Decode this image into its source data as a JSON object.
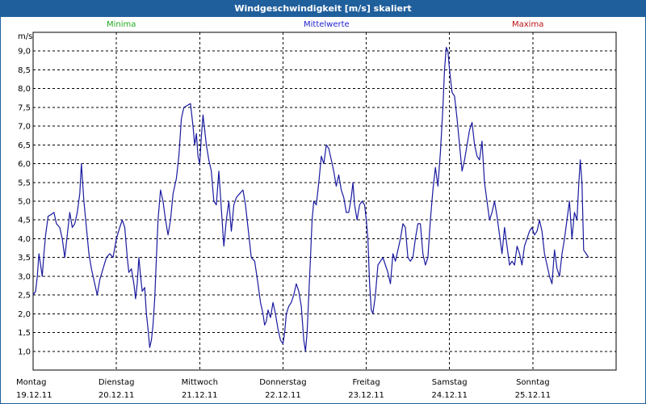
{
  "window": {
    "title": "Windgeschwindigkeit [m/s] skaliert"
  },
  "legend": [
    {
      "label": "Minima",
      "color": "#22aa22"
    },
    {
      "label": "Mittelwerte",
      "color": "#2222cc"
    },
    {
      "label": "Maxima",
      "color": "#bb1111"
    }
  ],
  "chart_data": {
    "type": "line",
    "ylabel": "m/s",
    "ylim": [
      0.5,
      9.5
    ],
    "yticks": [
      "1,0",
      "1,5",
      "2,0",
      "2,5",
      "3,0",
      "3,5",
      "4,0",
      "4,5",
      "5,0",
      "5,5",
      "6,0",
      "6,5",
      "7,0",
      "7,5",
      "8,0",
      "8,5",
      "9,0"
    ],
    "days": [
      {
        "name": "Montag",
        "date": "19.12.11"
      },
      {
        "name": "Dienstag",
        "date": "20.12.11"
      },
      {
        "name": "Mittwoch",
        "date": "21.12.11"
      },
      {
        "name": "Donnerstag",
        "date": "22.12.11"
      },
      {
        "name": "Freitag",
        "date": "23.12.11"
      },
      {
        "name": "Samstag",
        "date": "24.12.11"
      },
      {
        "name": "Sonntag",
        "date": "25.12.11"
      }
    ],
    "xlim": [
      0,
      7
    ],
    "grid": true,
    "series": [
      {
        "name": "Mittelwerte",
        "color": "#1a1aa0",
        "points": [
          [
            0.0,
            2.5
          ],
          [
            0.03,
            2.6
          ],
          [
            0.05,
            3.0
          ],
          [
            0.07,
            3.6
          ],
          [
            0.09,
            3.3
          ],
          [
            0.11,
            3.0
          ],
          [
            0.13,
            3.6
          ],
          [
            0.15,
            4.1
          ],
          [
            0.18,
            4.6
          ],
          [
            0.22,
            4.65
          ],
          [
            0.25,
            4.7
          ],
          [
            0.28,
            4.4
          ],
          [
            0.32,
            4.3
          ],
          [
            0.35,
            4.0
          ],
          [
            0.38,
            3.5
          ],
          [
            0.41,
            4.1
          ],
          [
            0.44,
            4.7
          ],
          [
            0.47,
            4.3
          ],
          [
            0.5,
            4.4
          ],
          [
            0.53,
            4.7
          ],
          [
            0.56,
            5.2
          ],
          [
            0.58,
            6.0
          ],
          [
            0.61,
            5.0
          ],
          [
            0.64,
            4.3
          ],
          [
            0.67,
            3.6
          ],
          [
            0.7,
            3.2
          ],
          [
            0.73,
            2.9
          ],
          [
            0.77,
            2.5
          ],
          [
            0.8,
            2.9
          ],
          [
            0.84,
            3.2
          ],
          [
            0.88,
            3.5
          ],
          [
            0.92,
            3.6
          ],
          [
            0.96,
            3.5
          ],
          [
            1.0,
            4.0
          ],
          [
            1.04,
            4.3
          ],
          [
            1.07,
            4.5
          ],
          [
            1.1,
            4.3
          ],
          [
            1.13,
            3.5
          ],
          [
            1.15,
            3.1
          ],
          [
            1.18,
            3.2
          ],
          [
            1.21,
            2.8
          ],
          [
            1.23,
            2.4
          ],
          [
            1.25,
            2.8
          ],
          [
            1.27,
            3.5
          ],
          [
            1.29,
            3.0
          ],
          [
            1.31,
            2.6
          ],
          [
            1.34,
            2.7
          ],
          [
            1.36,
            2.0
          ],
          [
            1.38,
            1.6
          ],
          [
            1.4,
            1.1
          ],
          [
            1.42,
            1.3
          ],
          [
            1.44,
            1.7
          ],
          [
            1.46,
            2.4
          ],
          [
            1.48,
            3.5
          ],
          [
            1.5,
            4.5
          ],
          [
            1.53,
            5.3
          ],
          [
            1.56,
            5.0
          ],
          [
            1.59,
            4.5
          ],
          [
            1.62,
            4.1
          ],
          [
            1.65,
            4.5
          ],
          [
            1.68,
            5.2
          ],
          [
            1.72,
            5.6
          ],
          [
            1.75,
            6.2
          ],
          [
            1.78,
            7.2
          ],
          [
            1.81,
            7.5
          ],
          [
            1.85,
            7.55
          ],
          [
            1.89,
            7.6
          ],
          [
            1.92,
            7.0
          ],
          [
            1.94,
            6.5
          ],
          [
            1.96,
            6.8
          ],
          [
            1.98,
            6.2
          ],
          [
            2.0,
            6.0
          ],
          [
            2.02,
            6.7
          ],
          [
            2.04,
            7.3
          ],
          [
            2.06,
            6.9
          ],
          [
            2.08,
            6.5
          ],
          [
            2.11,
            6.1
          ],
          [
            2.14,
            5.8
          ],
          [
            2.17,
            5.0
          ],
          [
            2.2,
            4.9
          ],
          [
            2.23,
            5.8
          ],
          [
            2.26,
            4.8
          ],
          [
            2.29,
            3.8
          ],
          [
            2.32,
            4.5
          ],
          [
            2.35,
            5.0
          ],
          [
            2.38,
            4.2
          ],
          [
            2.41,
            4.9
          ],
          [
            2.44,
            5.1
          ],
          [
            2.48,
            5.2
          ],
          [
            2.52,
            5.3
          ],
          [
            2.55,
            4.9
          ],
          [
            2.58,
            4.3
          ],
          [
            2.62,
            3.5
          ],
          [
            2.66,
            3.4
          ],
          [
            2.7,
            2.8
          ],
          [
            2.73,
            2.3
          ],
          [
            2.76,
            2.0
          ],
          [
            2.78,
            1.7
          ],
          [
            2.8,
            1.8
          ],
          [
            2.82,
            2.1
          ],
          [
            2.85,
            1.9
          ],
          [
            2.88,
            2.3
          ],
          [
            2.91,
            2.0
          ],
          [
            2.94,
            1.6
          ],
          [
            2.97,
            1.3
          ],
          [
            3.0,
            1.2
          ],
          [
            3.02,
            1.5
          ],
          [
            3.04,
            2.0
          ],
          [
            3.07,
            2.2
          ],
          [
            3.1,
            2.3
          ],
          [
            3.13,
            2.5
          ],
          [
            3.16,
            2.8
          ],
          [
            3.19,
            2.6
          ],
          [
            3.22,
            2.2
          ],
          [
            3.25,
            1.3
          ],
          [
            3.27,
            1.0
          ],
          [
            3.29,
            1.5
          ],
          [
            3.31,
            2.5
          ],
          [
            3.33,
            3.5
          ],
          [
            3.35,
            4.5
          ],
          [
            3.37,
            5.0
          ],
          [
            3.4,
            4.9
          ],
          [
            3.43,
            5.5
          ],
          [
            3.46,
            6.2
          ],
          [
            3.49,
            6.0
          ],
          [
            3.52,
            6.5
          ],
          [
            3.55,
            6.4
          ],
          [
            3.58,
            6.1
          ],
          [
            3.61,
            5.8
          ],
          [
            3.64,
            5.4
          ],
          [
            3.67,
            5.7
          ],
          [
            3.7,
            5.3
          ],
          [
            3.73,
            5.1
          ],
          [
            3.76,
            4.7
          ],
          [
            3.79,
            4.7
          ],
          [
            3.82,
            5.1
          ],
          [
            3.84,
            5.5
          ],
          [
            3.86,
            4.9
          ],
          [
            3.89,
            4.5
          ],
          [
            3.92,
            4.9
          ],
          [
            3.95,
            5.0
          ],
          [
            3.98,
            4.9
          ],
          [
            4.0,
            4.5
          ],
          [
            4.02,
            4.0
          ],
          [
            4.04,
            2.8
          ],
          [
            4.06,
            2.1
          ],
          [
            4.08,
            2.0
          ],
          [
            4.11,
            2.5
          ],
          [
            4.14,
            3.3
          ],
          [
            4.17,
            3.4
          ],
          [
            4.2,
            3.5
          ],
          [
            4.23,
            3.3
          ],
          [
            4.26,
            3.1
          ],
          [
            4.29,
            2.8
          ],
          [
            4.32,
            3.6
          ],
          [
            4.35,
            3.4
          ],
          [
            4.38,
            3.7
          ],
          [
            4.41,
            4.0
          ],
          [
            4.44,
            4.4
          ],
          [
            4.47,
            4.3
          ],
          [
            4.5,
            3.5
          ],
          [
            4.53,
            3.4
          ],
          [
            4.56,
            3.5
          ],
          [
            4.59,
            4.0
          ],
          [
            4.62,
            4.4
          ],
          [
            4.65,
            4.4
          ],
          [
            4.68,
            3.6
          ],
          [
            4.71,
            3.3
          ],
          [
            4.74,
            3.5
          ],
          [
            4.77,
            4.5
          ],
          [
            4.8,
            5.3
          ],
          [
            4.83,
            5.9
          ],
          [
            4.86,
            5.4
          ],
          [
            4.89,
            6.3
          ],
          [
            4.92,
            7.5
          ],
          [
            4.94,
            8.5
          ],
          [
            4.96,
            9.1
          ],
          [
            4.98,
            9.0
          ],
          [
            5.0,
            8.5
          ],
          [
            5.03,
            7.9
          ],
          [
            5.06,
            7.8
          ],
          [
            5.09,
            7.2
          ],
          [
            5.12,
            6.5
          ],
          [
            5.15,
            5.8
          ],
          [
            5.18,
            6.1
          ],
          [
            5.21,
            6.5
          ],
          [
            5.24,
            6.9
          ],
          [
            5.27,
            7.1
          ],
          [
            5.3,
            6.5
          ],
          [
            5.33,
            6.2
          ],
          [
            5.36,
            6.1
          ],
          [
            5.39,
            6.6
          ],
          [
            5.42,
            5.5
          ],
          [
            5.45,
            5.0
          ],
          [
            5.48,
            4.5
          ],
          [
            5.51,
            4.7
          ],
          [
            5.54,
            5.0
          ],
          [
            5.57,
            4.6
          ],
          [
            5.6,
            4.1
          ],
          [
            5.63,
            3.6
          ],
          [
            5.66,
            4.3
          ],
          [
            5.69,
            3.8
          ],
          [
            5.72,
            3.3
          ],
          [
            5.75,
            3.4
          ],
          [
            5.78,
            3.3
          ],
          [
            5.81,
            3.8
          ],
          [
            5.84,
            3.6
          ],
          [
            5.87,
            3.3
          ],
          [
            5.9,
            3.8
          ],
          [
            5.93,
            4.0
          ],
          [
            5.96,
            4.2
          ],
          [
            5.99,
            4.3
          ],
          [
            6.02,
            4.1
          ],
          [
            6.05,
            4.2
          ],
          [
            6.08,
            4.5
          ],
          [
            6.11,
            4.2
          ],
          [
            6.14,
            3.6
          ],
          [
            6.17,
            3.3
          ],
          [
            6.2,
            3.0
          ],
          [
            6.23,
            2.8
          ],
          [
            6.26,
            3.7
          ],
          [
            6.29,
            3.2
          ],
          [
            6.32,
            3.0
          ],
          [
            6.35,
            3.6
          ],
          [
            6.38,
            4.0
          ],
          [
            6.41,
            4.5
          ],
          [
            6.44,
            5.0
          ],
          [
            6.47,
            4.0
          ],
          [
            6.5,
            4.7
          ],
          [
            6.53,
            4.5
          ],
          [
            6.55,
            5.4
          ],
          [
            6.57,
            6.1
          ],
          [
            6.59,
            5.5
          ],
          [
            6.61,
            3.7
          ],
          [
            6.64,
            3.6
          ],
          [
            6.67,
            3.5
          ]
        ]
      }
    ]
  }
}
